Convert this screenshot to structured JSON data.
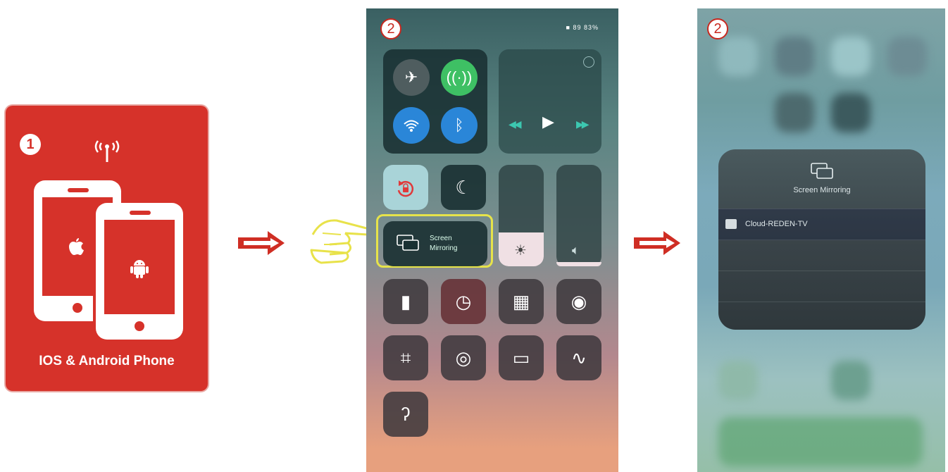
{
  "step1": {
    "badge": "1",
    "caption": "IOS & Android Phone",
    "bg_color": "#d6322a",
    "icons": [
      "broadcast-icon",
      "apple-icon",
      "android-icon"
    ]
  },
  "step2": {
    "badge": "2",
    "status_text": "■ 89 83%",
    "screen_mirroring_label_1": "Screen",
    "screen_mirroring_label_2": "Mirroring",
    "highlight_color": "#e6e34a"
  },
  "step3": {
    "badge": "2",
    "dialog_title": "Screen Mirroring",
    "device_name": "Cloud-REDEN-TV"
  },
  "arrow_color": "#cf2e24"
}
